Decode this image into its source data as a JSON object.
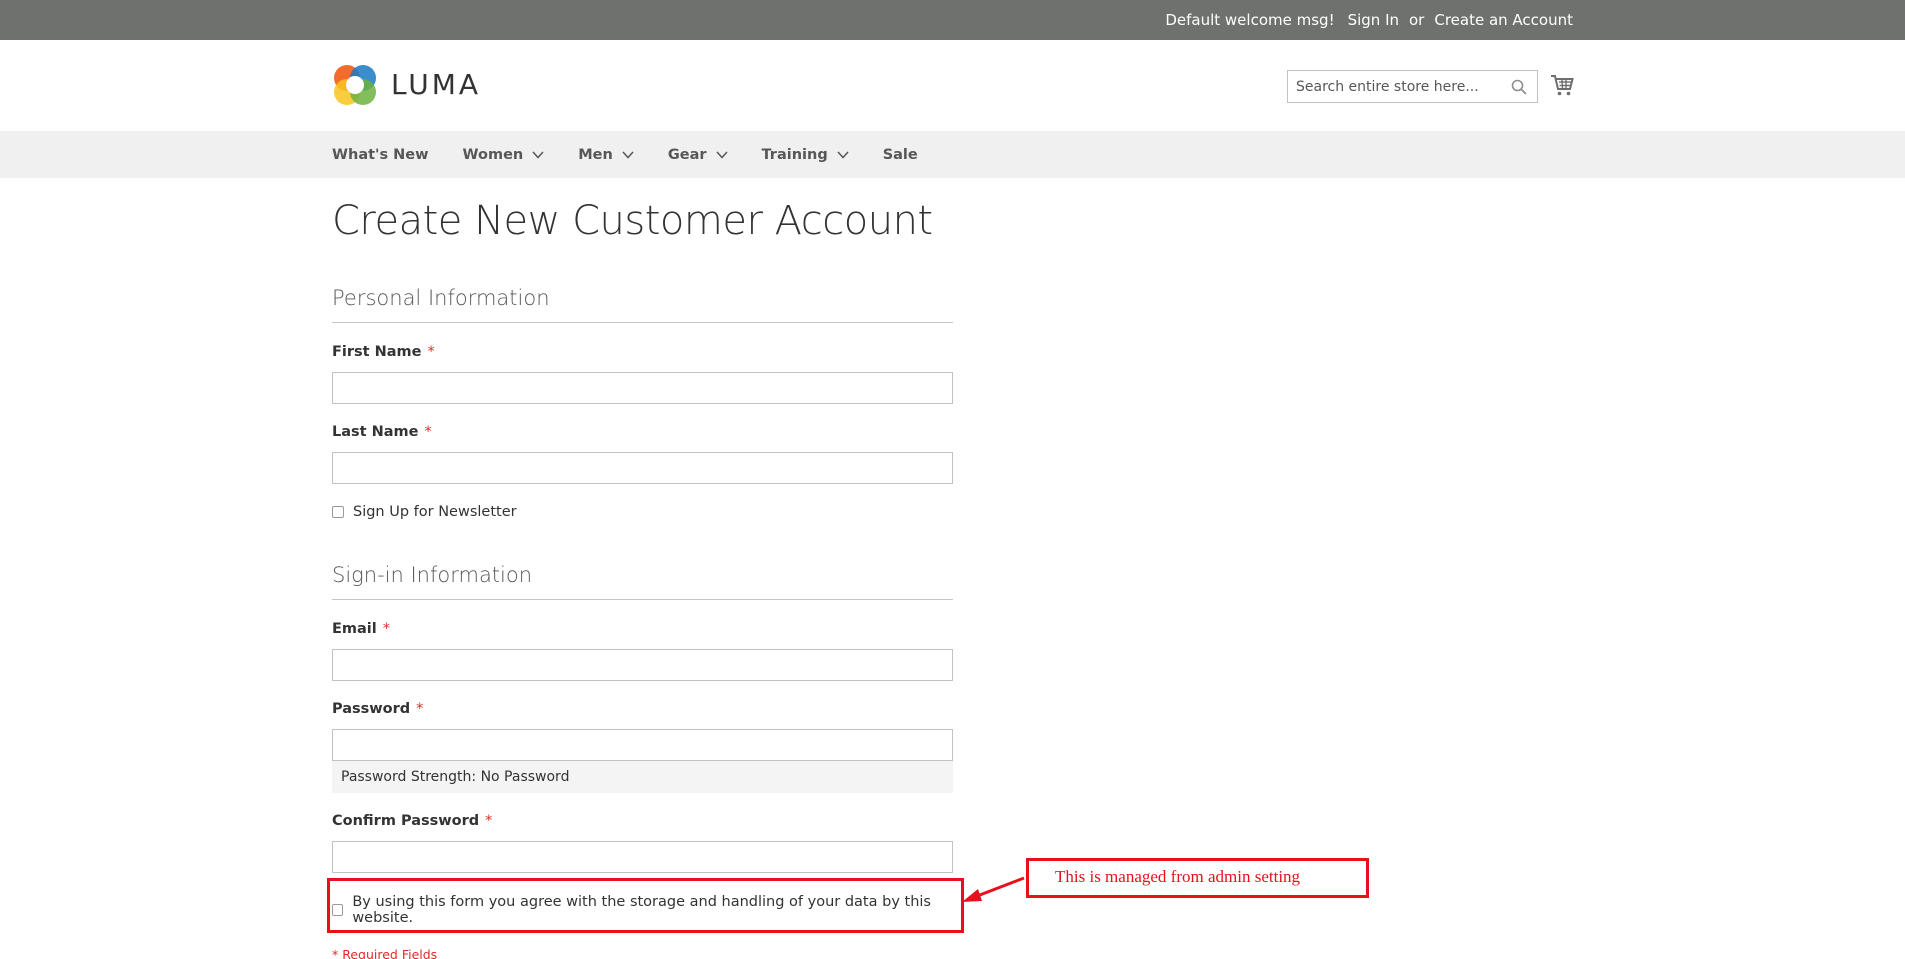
{
  "topbar": {
    "welcome": "Default welcome msg!",
    "sign_in": "Sign In",
    "or": "or",
    "create_account": "Create an Account"
  },
  "header": {
    "logo_text": "LUMA",
    "search_placeholder": "Search entire store here...",
    "search_value": ""
  },
  "nav": {
    "items": [
      {
        "label": "What's New",
        "has_dropdown": false
      },
      {
        "label": "Women",
        "has_dropdown": true
      },
      {
        "label": "Men",
        "has_dropdown": true
      },
      {
        "label": "Gear",
        "has_dropdown": true
      },
      {
        "label": "Training",
        "has_dropdown": true
      },
      {
        "label": "Sale",
        "has_dropdown": false
      }
    ]
  },
  "page": {
    "title": "Create New Customer Account"
  },
  "personal": {
    "section_title": "Personal Information",
    "first_name_label": "First Name",
    "first_name_value": "",
    "last_name_label": "Last Name",
    "last_name_value": "",
    "newsletter_label": "Sign Up for Newsletter",
    "newsletter_checked": false
  },
  "signin": {
    "section_title": "Sign-in Information",
    "email_label": "Email",
    "email_value": "",
    "password_label": "Password",
    "password_value": "",
    "password_strength": "Password Strength: No Password",
    "confirm_label": "Confirm Password",
    "confirm_value": ""
  },
  "consent": {
    "label": "By using this form you agree with the storage and handling of your data by this website.",
    "checked": false
  },
  "required_note": "* Required Fields",
  "required_marker": "*",
  "annotation": {
    "text": "This is managed from admin setting"
  },
  "colors": {
    "topbar_bg": "#6e716e",
    "nav_bg": "#f0f0f0",
    "required": "#e02b27",
    "annotation": "#e8101c"
  }
}
